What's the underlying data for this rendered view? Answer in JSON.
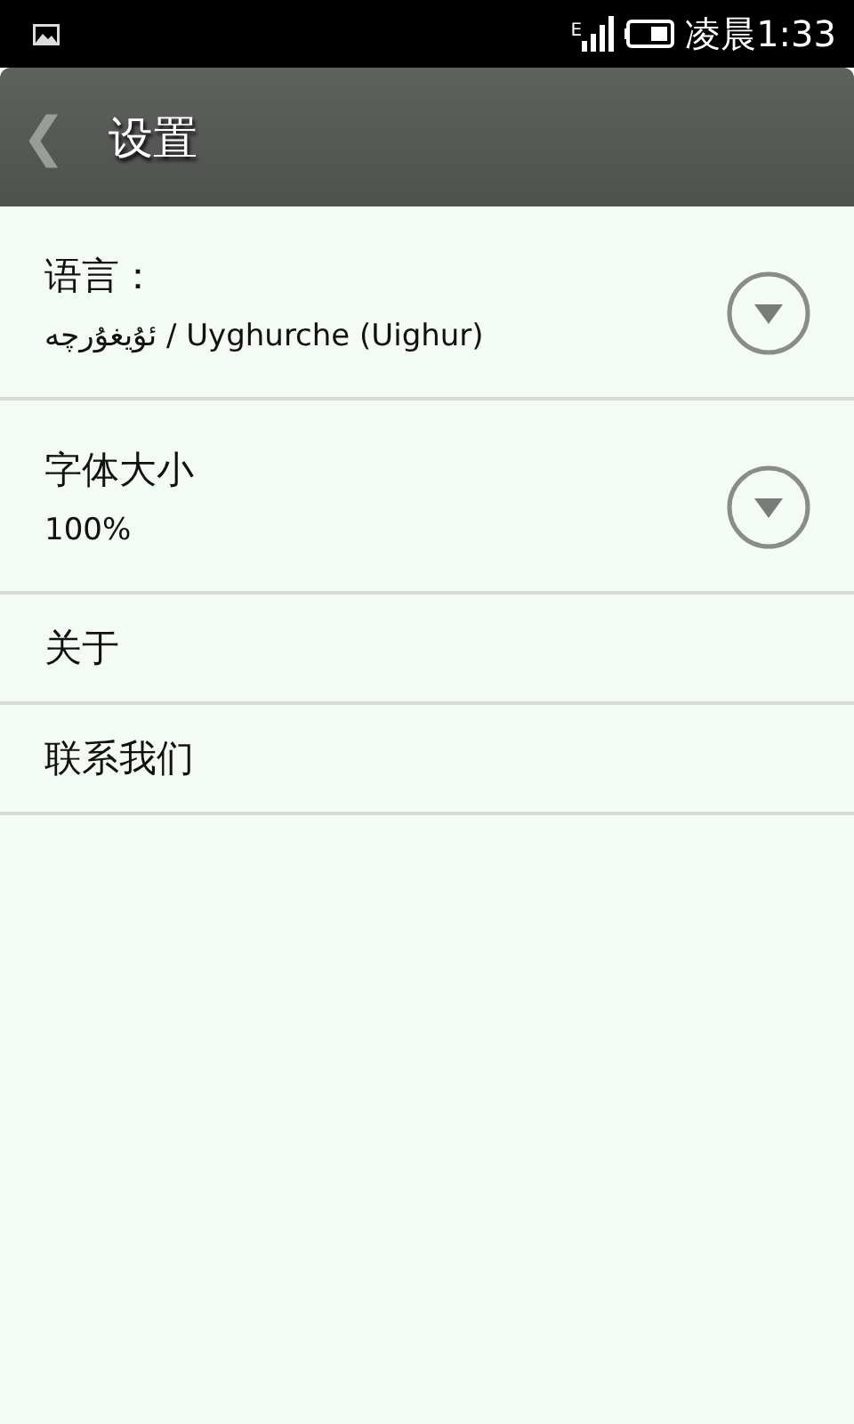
{
  "status_bar": {
    "network": "E",
    "time": "凌晨1:33"
  },
  "header": {
    "back": "❮",
    "title": "设置"
  },
  "settings": [
    {
      "kind": "dropdown",
      "label": "语言：",
      "value": "ئۇيغۇرچە / Uyghurche (Uighur)"
    },
    {
      "kind": "dropdown",
      "label": "字体大小",
      "value": "100%"
    },
    {
      "kind": "plain",
      "label": "关于"
    },
    {
      "kind": "plain",
      "label": "联系我们"
    }
  ]
}
